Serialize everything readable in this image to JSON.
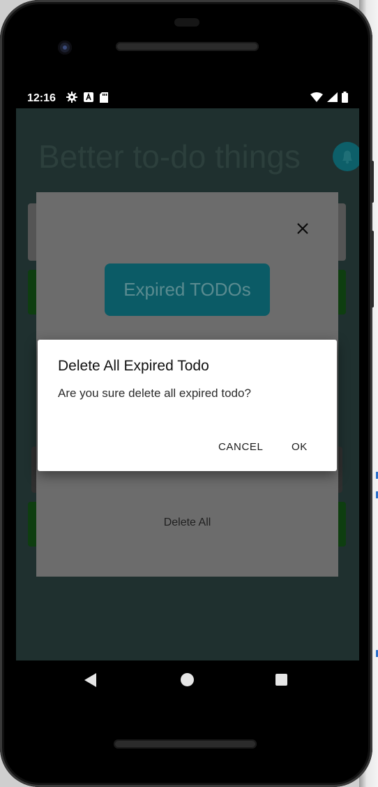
{
  "status_bar": {
    "time": "12:16",
    "left_icons": [
      "gear-icon",
      "a-box-icon",
      "sd-card-icon"
    ],
    "right_icons": [
      "wifi-icon",
      "signal-icon",
      "battery-icon"
    ]
  },
  "app": {
    "title": "Better to-do things",
    "accent_color": "#00BCD4",
    "card_color": "#1B5E20"
  },
  "sheet": {
    "expired_button_label": "Expired TODOs",
    "delete_all_label": "Delete All"
  },
  "dialog": {
    "title": "Delete All Expired Todo",
    "message": "Are you sure delete all expired todo?",
    "cancel_label": "CANCEL",
    "ok_label": "OK"
  }
}
